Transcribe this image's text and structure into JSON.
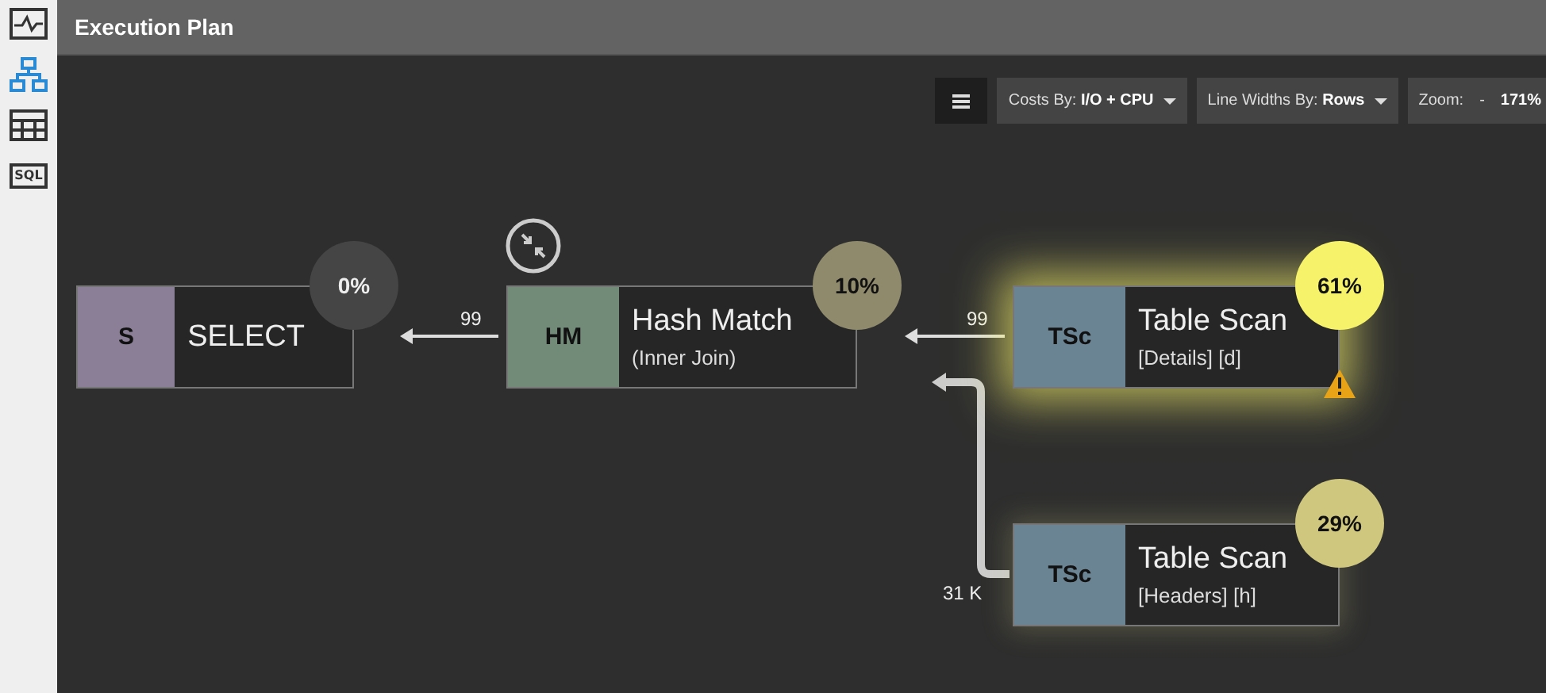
{
  "sidebar": {
    "items": [
      {
        "kind": "activity",
        "selected": false
      },
      {
        "kind": "plan",
        "selected": true
      },
      {
        "kind": "grid",
        "selected": false
      },
      {
        "kind": "sql",
        "label": "SQL",
        "selected": false
      }
    ]
  },
  "header": {
    "title": "Execution Plan"
  },
  "toolbar": {
    "costs": {
      "label": "Costs By:",
      "value": "I/O + CPU"
    },
    "line_widths": {
      "label": "Line Widths By:",
      "value": "Rows"
    },
    "zoom": {
      "label": "Zoom:",
      "minus": "-",
      "value": "171%"
    }
  },
  "nodes": [
    {
      "kind": "select",
      "abbr": "S",
      "title": "SELECT",
      "cost": "0%",
      "color": "#454545",
      "warning": false,
      "parallel": false
    },
    {
      "kind": "hash-match",
      "abbr": "HM",
      "title": "Hash Match",
      "subtitle": "(Inner Join)",
      "cost": "10%",
      "color": "#8f8a6c",
      "warning": false,
      "parallel": true
    },
    {
      "kind": "table-scan",
      "abbr": "TSc",
      "title": "Table Scan",
      "subtitle": "[Details] [d]",
      "cost": "61%",
      "color": "#f6f26a",
      "warning": true,
      "parallel": false
    },
    {
      "kind": "table-scan",
      "abbr": "TSc",
      "title": "Table Scan",
      "subtitle": "[Headers] [h]",
      "cost": "29%",
      "color": "#cfc77e",
      "warning": false,
      "parallel": false
    }
  ],
  "edges": [
    {
      "kind": "straight",
      "rows": "99"
    },
    {
      "kind": "straight",
      "rows": "99"
    },
    {
      "kind": "elbow",
      "rows": "31 K"
    }
  ]
}
